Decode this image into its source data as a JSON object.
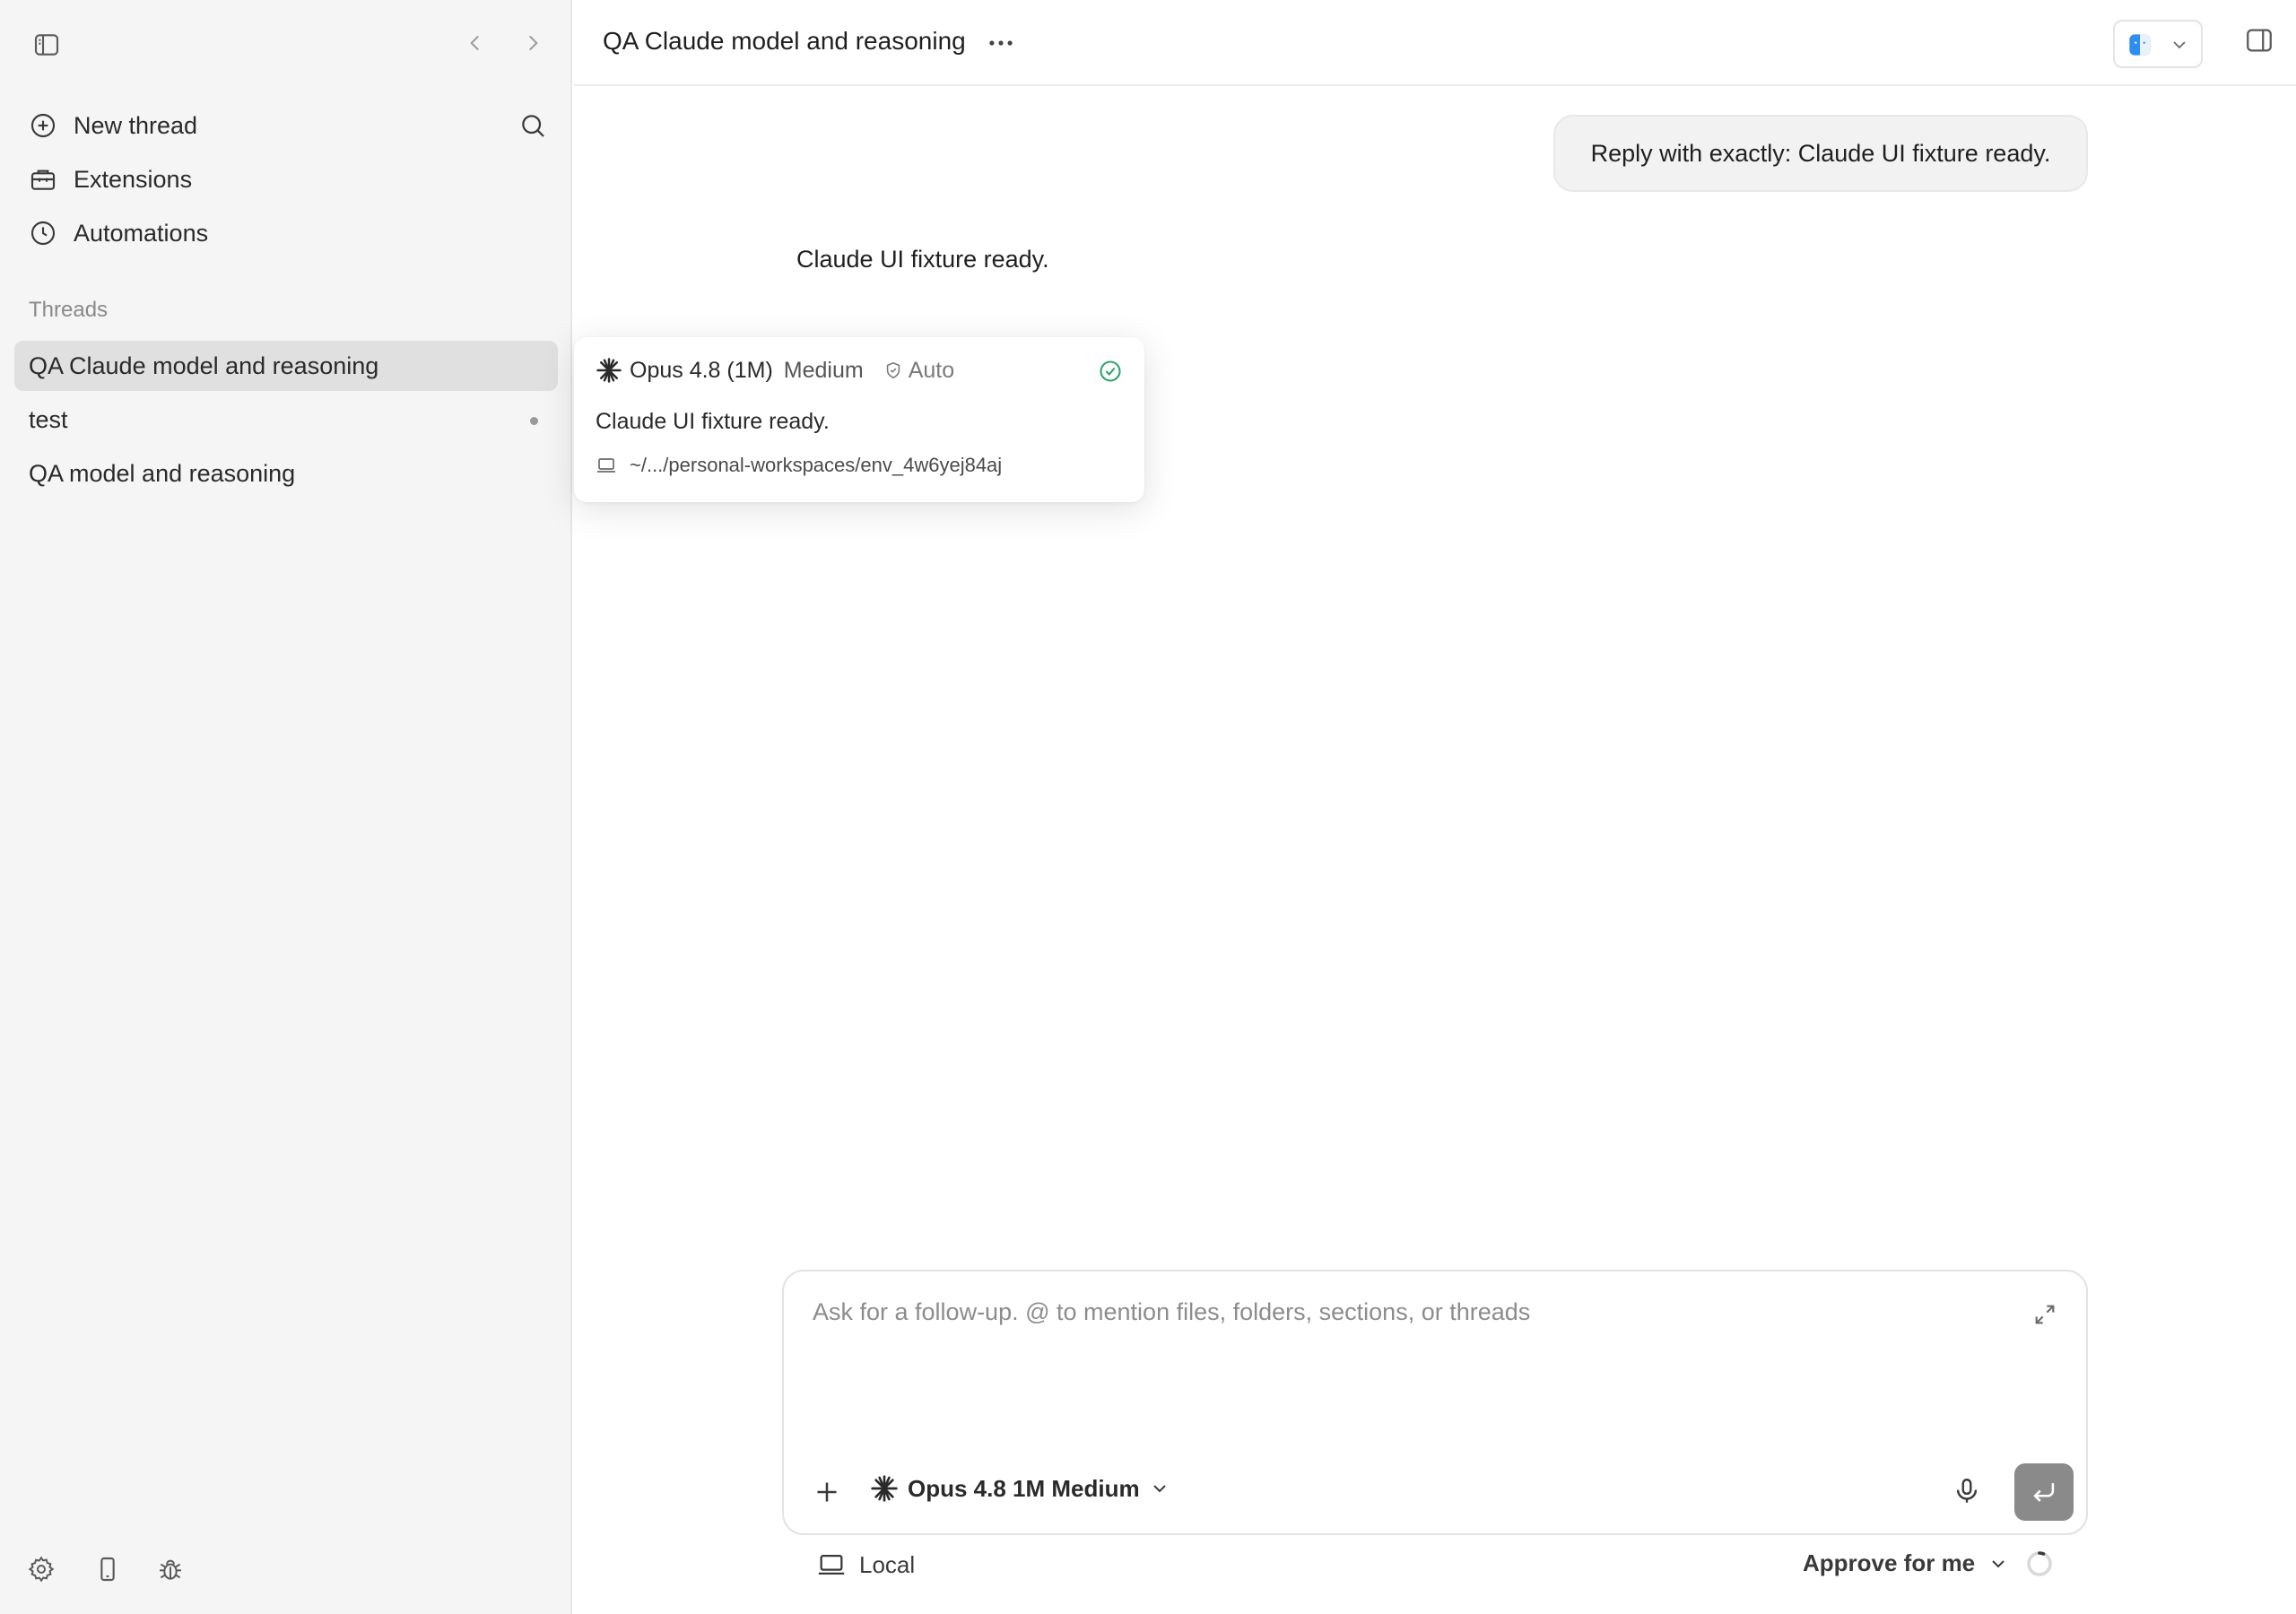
{
  "sidebar": {
    "nav": [
      {
        "label": "New thread",
        "icon": "plus-circle-icon"
      },
      {
        "label": "Extensions",
        "icon": "toolbox-icon"
      },
      {
        "label": "Automations",
        "icon": "clock-icon"
      }
    ],
    "section_label": "Threads",
    "threads": [
      {
        "label": "QA Claude model and reasoning",
        "active": true
      },
      {
        "label": "test",
        "unread": true
      },
      {
        "label": "QA model and reasoning"
      }
    ]
  },
  "header": {
    "title": "QA Claude model and reasoning"
  },
  "chat": {
    "user_message": "Reply with exactly: Claude UI fixture ready.",
    "assistant_message": "Claude UI fixture ready."
  },
  "hover_card": {
    "model": "Opus 4.8 (1M)",
    "effort": "Medium",
    "mode": "Auto",
    "message": "Claude UI fixture ready.",
    "path": "~/.../personal-workspaces/env_4w6yej84aj"
  },
  "composer": {
    "placeholder": "Ask for a follow-up. @ to mention files, folders, sections, or threads",
    "model_label": "Opus 4.8 1M Medium"
  },
  "footer": {
    "location": "Local",
    "approval": "Approve for me"
  },
  "colors": {
    "sidebar_bg": "#f5f5f5",
    "active_thread_bg": "#e0e0e0",
    "success_green": "#2fa36b",
    "send_button": "#8a8a8a"
  }
}
